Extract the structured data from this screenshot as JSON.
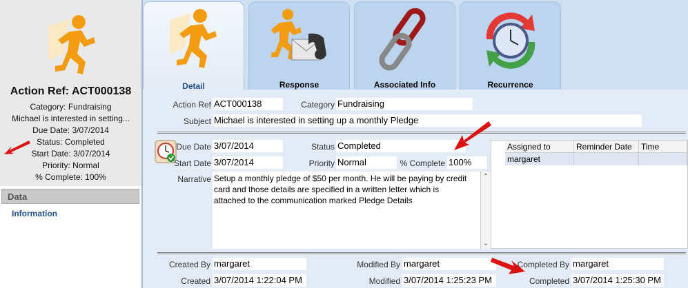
{
  "summary": {
    "title": "Action Ref: ACT000138",
    "lines": [
      "Category: Fundraising",
      "Michael is interested in setting...",
      "Due Date: 3/07/2014",
      "Status: Completed",
      "Start Date: 3/07/2014",
      "Priority: Normal",
      "% Complete: 100%"
    ]
  },
  "sidebar": {
    "header": "Data",
    "items": [
      {
        "label": "Information"
      }
    ]
  },
  "tabs": [
    {
      "label": "Detail",
      "icon": "runner-icon",
      "active": true
    },
    {
      "label": "Response",
      "icon": "runner-phone-icon",
      "active": false
    },
    {
      "label": "Associated Info",
      "icon": "chain-link-icon",
      "active": false
    },
    {
      "label": "Recurrence",
      "icon": "recurrence-clock-icon",
      "active": false
    }
  ],
  "form": {
    "action_ref": {
      "label": "Action Ref",
      "value": "ACT000138"
    },
    "category": {
      "label": "Category",
      "value": "Fundraising"
    },
    "subject": {
      "label": "Subject",
      "value": "Michael is interested in setting up a monthly Pledge"
    },
    "due_date": {
      "label": "Due Date",
      "value": "3/07/2014"
    },
    "start_date": {
      "label": "Start Date",
      "value": "3/07/2014"
    },
    "status": {
      "label": "Status",
      "value": "Completed"
    },
    "priority": {
      "label": "Priority",
      "value": "Normal"
    },
    "pct_complete": {
      "label": "% Complete",
      "value": "100%"
    },
    "narrative": {
      "label": "Narrative",
      "value": "Setup a monthly pledge of $50 per month. He will be paying by credit card and those details are specified in a written letter which is attached to the communication marked Pledge Details"
    }
  },
  "assigned": {
    "columns": [
      "Assigned to",
      "Reminder Date",
      "Time"
    ],
    "rows": [
      [
        "margaret",
        "",
        ""
      ]
    ]
  },
  "audit": {
    "created_by": {
      "label": "Created By",
      "value": "margaret"
    },
    "created": {
      "label": "Created",
      "value": "3/07/2014 1:22:04 PM"
    },
    "modified_by": {
      "label": "Modified By",
      "value": "margaret"
    },
    "modified": {
      "label": "Modified",
      "value": "3/07/2014 1:25:23 PM"
    },
    "completed_by": {
      "label": "Completed By",
      "value": "margaret"
    },
    "completed": {
      "label": "Completed",
      "value": "3/07/2014 1:25:30 PM"
    }
  },
  "colors": {
    "accent": "#1f4e8c",
    "runner": "#f39c12",
    "arrow": "#dd1111"
  }
}
